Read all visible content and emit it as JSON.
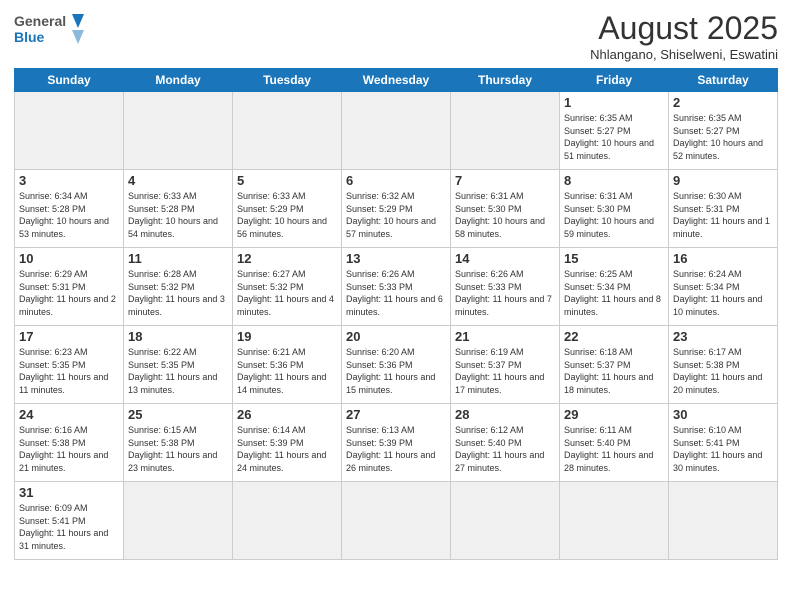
{
  "header": {
    "logo_general": "General",
    "logo_blue": "Blue",
    "month_title": "August 2025",
    "location": "Nhlangano, Shiselweni, Eswatini"
  },
  "days_of_week": [
    "Sunday",
    "Monday",
    "Tuesday",
    "Wednesday",
    "Thursday",
    "Friday",
    "Saturday"
  ],
  "cells": [
    {
      "day": null,
      "empty": true
    },
    {
      "day": null,
      "empty": true
    },
    {
      "day": null,
      "empty": true
    },
    {
      "day": null,
      "empty": true
    },
    {
      "day": null,
      "empty": true
    },
    {
      "day": "1",
      "info": "Sunrise: 6:35 AM\nSunset: 5:27 PM\nDaylight: 10 hours\nand 51 minutes."
    },
    {
      "day": "2",
      "info": "Sunrise: 6:35 AM\nSunset: 5:27 PM\nDaylight: 10 hours\nand 52 minutes."
    },
    {
      "day": "3",
      "info": "Sunrise: 6:34 AM\nSunset: 5:28 PM\nDaylight: 10 hours\nand 53 minutes."
    },
    {
      "day": "4",
      "info": "Sunrise: 6:33 AM\nSunset: 5:28 PM\nDaylight: 10 hours\nand 54 minutes."
    },
    {
      "day": "5",
      "info": "Sunrise: 6:33 AM\nSunset: 5:29 PM\nDaylight: 10 hours\nand 56 minutes."
    },
    {
      "day": "6",
      "info": "Sunrise: 6:32 AM\nSunset: 5:29 PM\nDaylight: 10 hours\nand 57 minutes."
    },
    {
      "day": "7",
      "info": "Sunrise: 6:31 AM\nSunset: 5:30 PM\nDaylight: 10 hours\nand 58 minutes."
    },
    {
      "day": "8",
      "info": "Sunrise: 6:31 AM\nSunset: 5:30 PM\nDaylight: 10 hours\nand 59 minutes."
    },
    {
      "day": "9",
      "info": "Sunrise: 6:30 AM\nSunset: 5:31 PM\nDaylight: 11 hours\nand 1 minute."
    },
    {
      "day": "10",
      "info": "Sunrise: 6:29 AM\nSunset: 5:31 PM\nDaylight: 11 hours\nand 2 minutes."
    },
    {
      "day": "11",
      "info": "Sunrise: 6:28 AM\nSunset: 5:32 PM\nDaylight: 11 hours\nand 3 minutes."
    },
    {
      "day": "12",
      "info": "Sunrise: 6:27 AM\nSunset: 5:32 PM\nDaylight: 11 hours\nand 4 minutes."
    },
    {
      "day": "13",
      "info": "Sunrise: 6:26 AM\nSunset: 5:33 PM\nDaylight: 11 hours\nand 6 minutes."
    },
    {
      "day": "14",
      "info": "Sunrise: 6:26 AM\nSunset: 5:33 PM\nDaylight: 11 hours\nand 7 minutes."
    },
    {
      "day": "15",
      "info": "Sunrise: 6:25 AM\nSunset: 5:34 PM\nDaylight: 11 hours\nand 8 minutes."
    },
    {
      "day": "16",
      "info": "Sunrise: 6:24 AM\nSunset: 5:34 PM\nDaylight: 11 hours\nand 10 minutes."
    },
    {
      "day": "17",
      "info": "Sunrise: 6:23 AM\nSunset: 5:35 PM\nDaylight: 11 hours\nand 11 minutes."
    },
    {
      "day": "18",
      "info": "Sunrise: 6:22 AM\nSunset: 5:35 PM\nDaylight: 11 hours\nand 13 minutes."
    },
    {
      "day": "19",
      "info": "Sunrise: 6:21 AM\nSunset: 5:36 PM\nDaylight: 11 hours\nand 14 minutes."
    },
    {
      "day": "20",
      "info": "Sunrise: 6:20 AM\nSunset: 5:36 PM\nDaylight: 11 hours\nand 15 minutes."
    },
    {
      "day": "21",
      "info": "Sunrise: 6:19 AM\nSunset: 5:37 PM\nDaylight: 11 hours\nand 17 minutes."
    },
    {
      "day": "22",
      "info": "Sunrise: 6:18 AM\nSunset: 5:37 PM\nDaylight: 11 hours\nand 18 minutes."
    },
    {
      "day": "23",
      "info": "Sunrise: 6:17 AM\nSunset: 5:38 PM\nDaylight: 11 hours\nand 20 minutes."
    },
    {
      "day": "24",
      "info": "Sunrise: 6:16 AM\nSunset: 5:38 PM\nDaylight: 11 hours\nand 21 minutes."
    },
    {
      "day": "25",
      "info": "Sunrise: 6:15 AM\nSunset: 5:38 PM\nDaylight: 11 hours\nand 23 minutes."
    },
    {
      "day": "26",
      "info": "Sunrise: 6:14 AM\nSunset: 5:39 PM\nDaylight: 11 hours\nand 24 minutes."
    },
    {
      "day": "27",
      "info": "Sunrise: 6:13 AM\nSunset: 5:39 PM\nDaylight: 11 hours\nand 26 minutes."
    },
    {
      "day": "28",
      "info": "Sunrise: 6:12 AM\nSunset: 5:40 PM\nDaylight: 11 hours\nand 27 minutes."
    },
    {
      "day": "29",
      "info": "Sunrise: 6:11 AM\nSunset: 5:40 PM\nDaylight: 11 hours\nand 28 minutes."
    },
    {
      "day": "30",
      "info": "Sunrise: 6:10 AM\nSunset: 5:41 PM\nDaylight: 11 hours\nand 30 minutes."
    },
    {
      "day": "31",
      "info": "Sunrise: 6:09 AM\nSunset: 5:41 PM\nDaylight: 11 hours\nand 31 minutes."
    },
    {
      "day": null,
      "empty": true
    },
    {
      "day": null,
      "empty": true
    },
    {
      "day": null,
      "empty": true
    },
    {
      "day": null,
      "empty": true
    },
    {
      "day": null,
      "empty": true
    },
    {
      "day": null,
      "empty": true
    }
  ]
}
